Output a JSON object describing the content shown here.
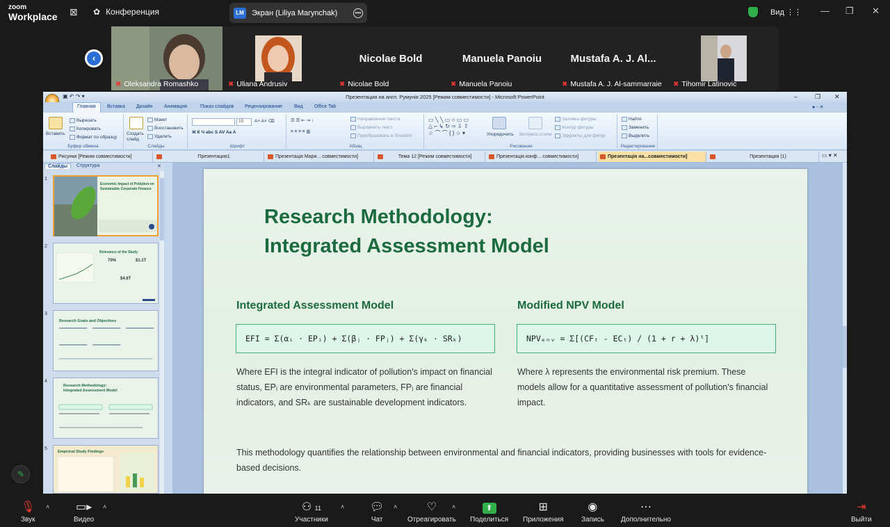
{
  "zoom": {
    "brand_top": "zoom",
    "brand_bottom": "Workplace",
    "meeting_label": "Конференция",
    "screen_share": {
      "initials": "LM",
      "label": "Экран (Liliya Marynchak)"
    },
    "view_label": "Вид",
    "participants": [
      {
        "name": "Oleksandra Romashko",
        "big": ""
      },
      {
        "name": "Uliana Andrusiv",
        "big": ""
      },
      {
        "name": "Nicolae Bold",
        "big": "Nicolae Bold"
      },
      {
        "name": "Manuela Panoiu",
        "big": "Manuela Panoiu"
      },
      {
        "name": "Mustafa A. J. Al-sammarraie",
        "big": "Mustafa A. J. Al..."
      },
      {
        "name": "Tihomir Latinovic",
        "big": ""
      }
    ],
    "toolbar": {
      "audio": "Звук",
      "video": "Видео",
      "participants": "Участники",
      "participants_count": "11",
      "chat": "Чат",
      "react": "Отреагировать",
      "share": "Поделиться",
      "apps": "Приложения",
      "record": "Запись",
      "more": "Дополнительно",
      "leave": "Выйти"
    }
  },
  "ppt": {
    "window_title": "Презентация на англ. Румунія 2025 [Режим совместимости] - Microsoft PowerPoint",
    "ribbon_tabs": [
      "Главная",
      "Вставка",
      "Дизайн",
      "Анимация",
      "Показ слайдов",
      "Рецензирование",
      "Вид",
      "Office Tab"
    ],
    "ribbon": {
      "paste": "Вставить",
      "cut": "Вырезать",
      "copy": "Копировать",
      "format_painter": "Формат по образцу",
      "clipboard": "Буфер обмена",
      "layout": "Макет",
      "reset": "Восстановить",
      "new_slide": "Создать слайд",
      "delete": "Удалить",
      "slides": "Слайды",
      "font_size": "15",
      "font": "Шрифт",
      "text_direction": "Направление текста",
      "align_text": "Выровнять текст",
      "smartart": "Преобразовать в SmartArt",
      "paragraph": "Абзац",
      "arrange": "Упорядочить",
      "quick_styles": "Экспресс-стили",
      "shape_fill": "Заливка фигуры",
      "shape_outline": "Контур фигуры",
      "shape_effects": "Эффекты для фигур",
      "drawing": "Рисование",
      "find": "Найти",
      "replace": "Заменить",
      "select": "Выделить",
      "editing": "Редактирование"
    },
    "doc_tabs": [
      "Рисунки [Режим совместимости]",
      "Презентация1",
      "Презентація Мари... совместимости]",
      "Тема 12 [Режим совместимости]",
      "Презентація конф... совместимости]",
      "Презентація на...совместимости]",
      "Презентация (1)"
    ],
    "left_tabs": {
      "slides": "Слайды",
      "outline": "Структура"
    },
    "thumbs": [
      {
        "num": "1",
        "title": "Economic Impact of Pollution on Sustainable Corporate Finance"
      },
      {
        "num": "2",
        "title": "Relevance of the Study",
        "stats": [
          "70%",
          "$1.1T",
          "$4.6T"
        ]
      },
      {
        "num": "3",
        "title": "Research Goals and Objectives"
      },
      {
        "num": "4",
        "title": "Research Methodology: Integrated Assessment Model"
      },
      {
        "num": "5",
        "title": "Empirical Study Findings"
      }
    ]
  },
  "slide": {
    "title_line1": "Research Methodology:",
    "title_line2": "Integrated Assessment Model",
    "left_heading": "Integrated Assessment Model",
    "right_heading": "Modified NPV Model",
    "formula_left": "EFI = Σ(αᵢ · EPᵢ) + Σ(βⱼ · FPⱼ) + Σ(γₖ · SRₖ)",
    "formula_right": "NPVₑₙᵥ = Σ[(CFₜ - ECₜ) / (1 + r + λ)ᵗ]",
    "left_text": "Where EFI is the integral indicator of pollution's impact on financial status, EPᵢ are environmental parameters, FPⱼ are financial indicators, and SRₖ are sustainable development indicators.",
    "right_text": "Where λ represents the environmental risk premium. These models allow for a quantitative assessment of pollution's financial impact.",
    "bottom_text": "This methodology quantifies the relationship between environmental and financial indicators, providing businesses with tools for evidence-based decisions."
  },
  "colors": {
    "accent_green": "#1b6b3f",
    "zoom_blue": "#2b6fd6",
    "formula_bg": "#dcf7ea"
  }
}
